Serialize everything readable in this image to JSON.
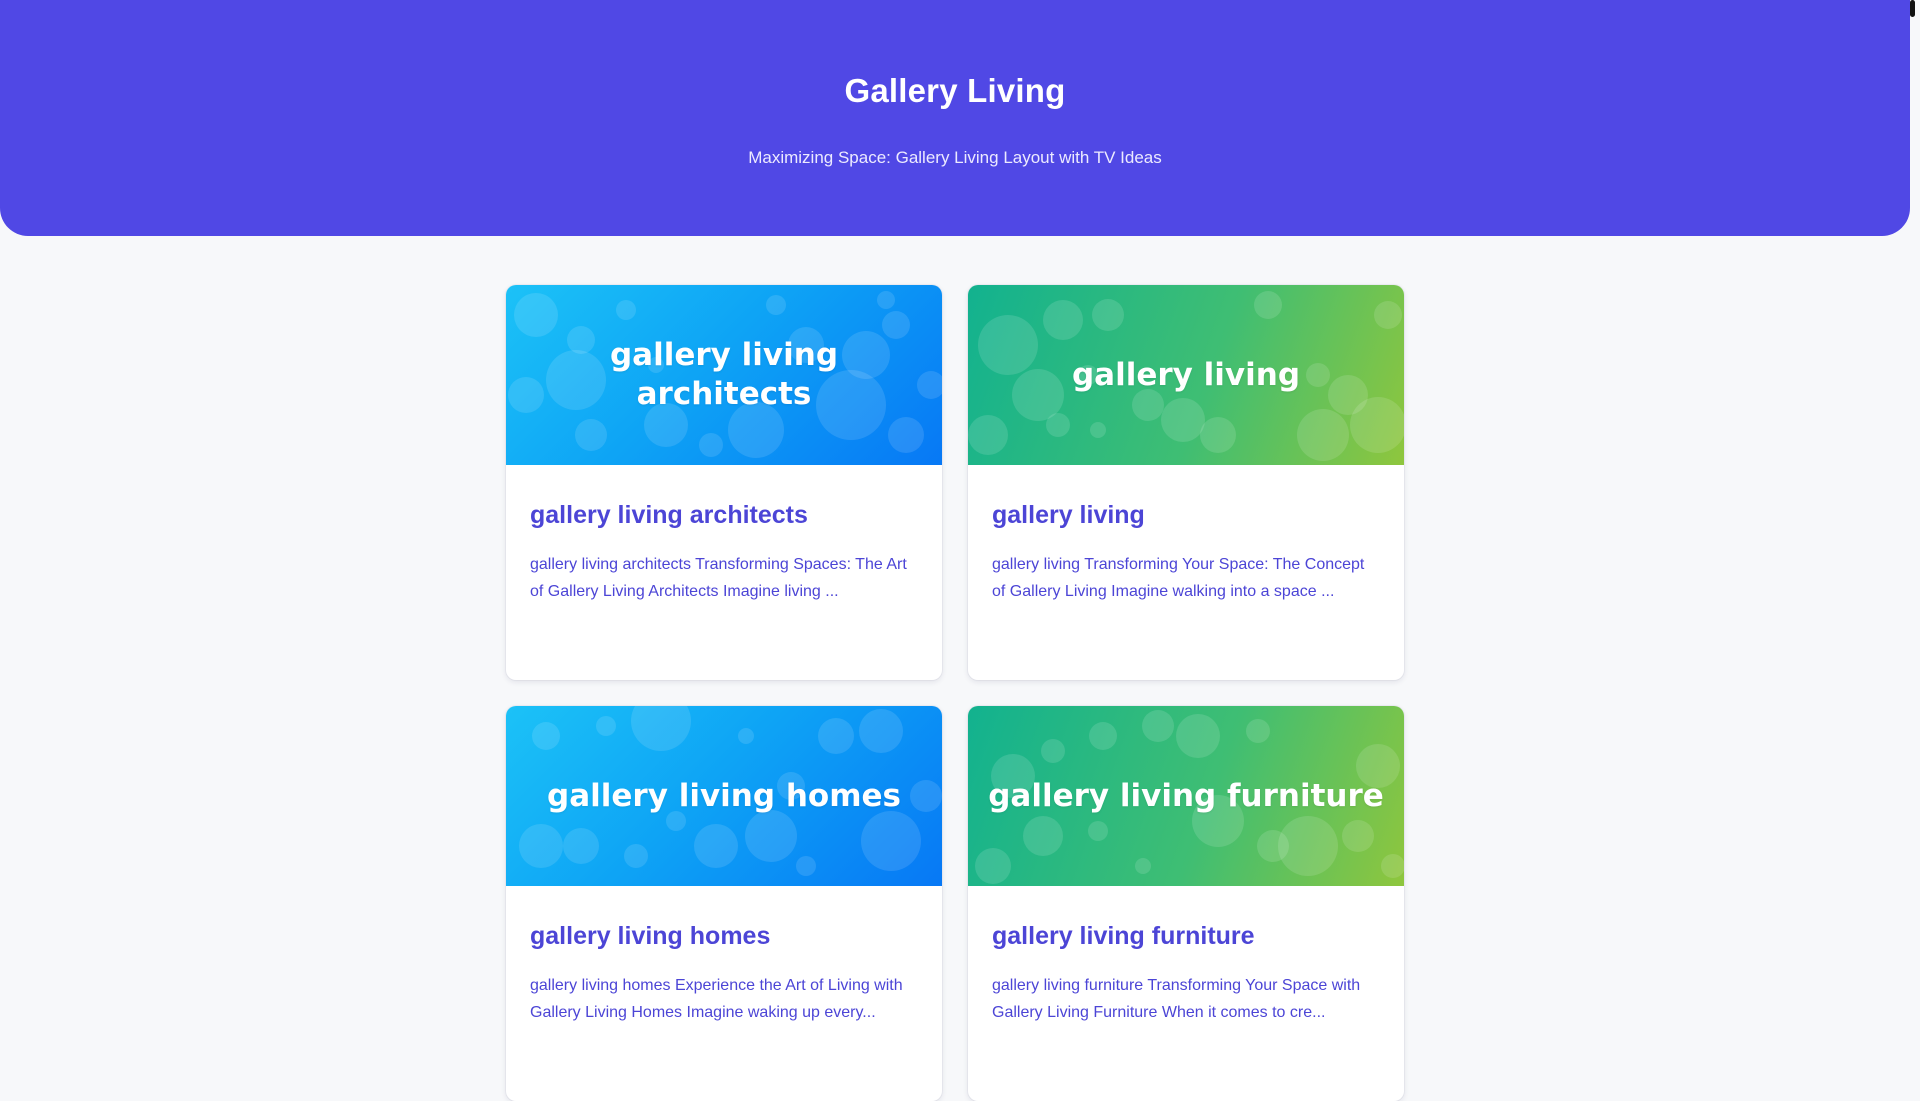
{
  "header": {
    "title": "Gallery Living",
    "subtitle": "Maximizing Space: Gallery Living Layout with TV Ideas"
  },
  "colors": {
    "hero_background": "#5048e5",
    "link_text": "#4c45d6",
    "page_background": "#f7f8fa"
  },
  "posts": [
    {
      "banner_text": "gallery living architects",
      "banner_style": "blue",
      "title": "gallery living architects",
      "excerpt": "gallery living architects Transforming Spaces: The Art of Gallery Living Architects Imagine living ..."
    },
    {
      "banner_text": "gallery living",
      "banner_style": "green",
      "title": "gallery living",
      "excerpt": "gallery living Transforming Your Space: The Concept of Gallery Living Imagine walking into a space ..."
    },
    {
      "banner_text": "gallery living homes",
      "banner_style": "blue",
      "title": "gallery living homes",
      "excerpt": "gallery living homes Experience the Art of Living with Gallery Living Homes Imagine waking up every..."
    },
    {
      "banner_text": "gallery living furniture",
      "banner_style": "green",
      "title": "gallery living furniture",
      "excerpt": "gallery living furniture Transforming Your Space with Gallery Living Furniture When it comes to cre..."
    }
  ]
}
